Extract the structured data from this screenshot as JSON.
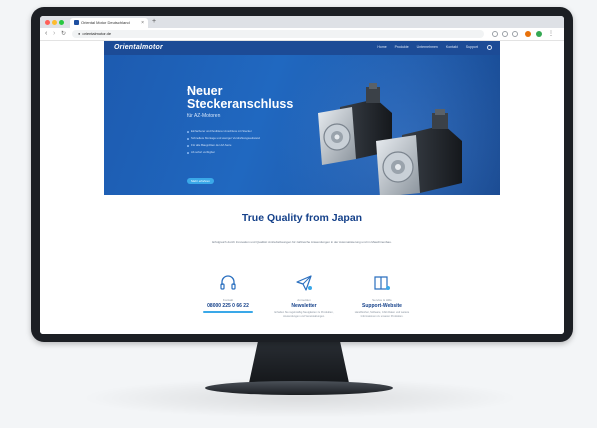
{
  "browser": {
    "tab_title": "Oriental Motor Deutschland",
    "new_tab": "+",
    "url": "orientalmotor.de",
    "nav_back": "‹",
    "nav_forward": "›",
    "nav_reload": "↻"
  },
  "site": {
    "logo": "Orientalmotor",
    "nav_items": [
      "Home",
      "Produkte",
      "Unternehmen",
      "Kontakt",
      "Support"
    ]
  },
  "hero": {
    "title": "Neuer Steckeranschluss",
    "subtitle": "für AZ-Motoren",
    "bullets": [
      "Einfacherer und flexiblerer Anschluss mit Stecker",
      "Schnellere Montage und weniger Verdrahtungsaufwand",
      "Für alle Baugrößen der AZ-Serie",
      "Ab sofort verfügbar"
    ],
    "button": "Mehr erfahren"
  },
  "intro": {
    "title": "True Quality from Japan",
    "description": "Erfolgreich durch Innovation und Qualität: Antriebslösungen für zahlreiche Anwendungen in der Automatisierung und im Maschinenbau."
  },
  "features": [
    {
      "icon": "headset-icon",
      "caption": "Kontakt",
      "title": "08000 225 0 66 22",
      "text": ""
    },
    {
      "icon": "paper-plane-icon",
      "caption": "Anmelden",
      "title": "Newsletter",
      "text": "Erhalten Sie regelmäßig Neuigkeiten zu Produkten, Anwendungen und Veranstaltungen."
    },
    {
      "icon": "book-icon",
      "caption": "Service & Hilfe",
      "title": "Support-Website",
      "text": "Handbücher, Software, CAD-Daten und weitere Informationen zu unseren Produkten."
    }
  ],
  "colors": {
    "brand_navy": "#1c4b96",
    "hero_blue": "#2068c0",
    "accent_cyan": "#3aa8e8",
    "heading": "#15418a"
  }
}
